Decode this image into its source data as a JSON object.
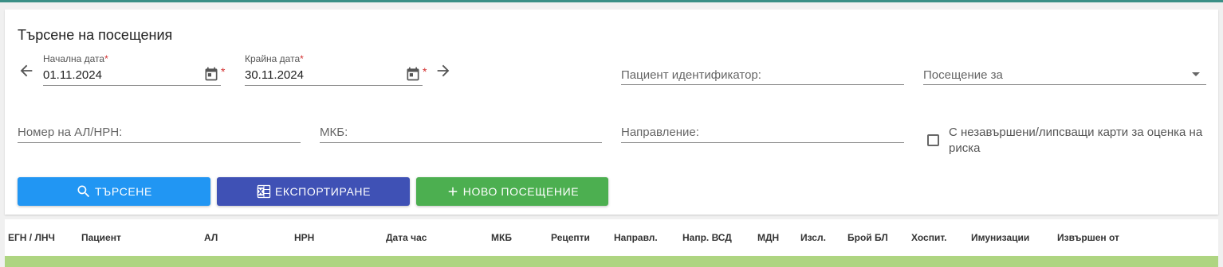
{
  "title": "Търсене на посещения",
  "start_date": {
    "label": "Начална дата",
    "required_mark": "*",
    "value": "01.11.2024"
  },
  "end_date": {
    "label": "Крайна дата",
    "required_mark": "*",
    "value": "30.11.2024"
  },
  "required_mark": "*",
  "patient_id": {
    "placeholder": "Пациент идентификатор:"
  },
  "visit_for": {
    "placeholder": "Посещение за"
  },
  "al_nrn": {
    "placeholder": "Номер на АЛ/НРН:"
  },
  "mkb": {
    "placeholder": "МКБ:"
  },
  "direction": {
    "placeholder": "Направление:"
  },
  "risk_checkbox": {
    "label": "С незавършени/липсващи карти за оценка на риска"
  },
  "buttons": {
    "search": "ТЪРСЕНЕ",
    "export": "ЕКСПОРТИРАНЕ",
    "new_visit": "НОВО ПОСЕЩЕНИЕ"
  },
  "colors": {
    "search": "#2196f3",
    "export": "#3f51b5",
    "new_visit": "#4caf50",
    "row": "#aed581"
  },
  "table": {
    "columns": [
      "ЕГН / ЛНЧ",
      "Пациент",
      "АЛ",
      "НРН",
      "Дата час",
      "МКБ",
      "Рецепти",
      "Направл.",
      "Напр. ВСД",
      "МДН",
      "Изсл.",
      "Брой БЛ",
      "Хоспит.",
      "Имунизации",
      "Извършен от"
    ]
  }
}
